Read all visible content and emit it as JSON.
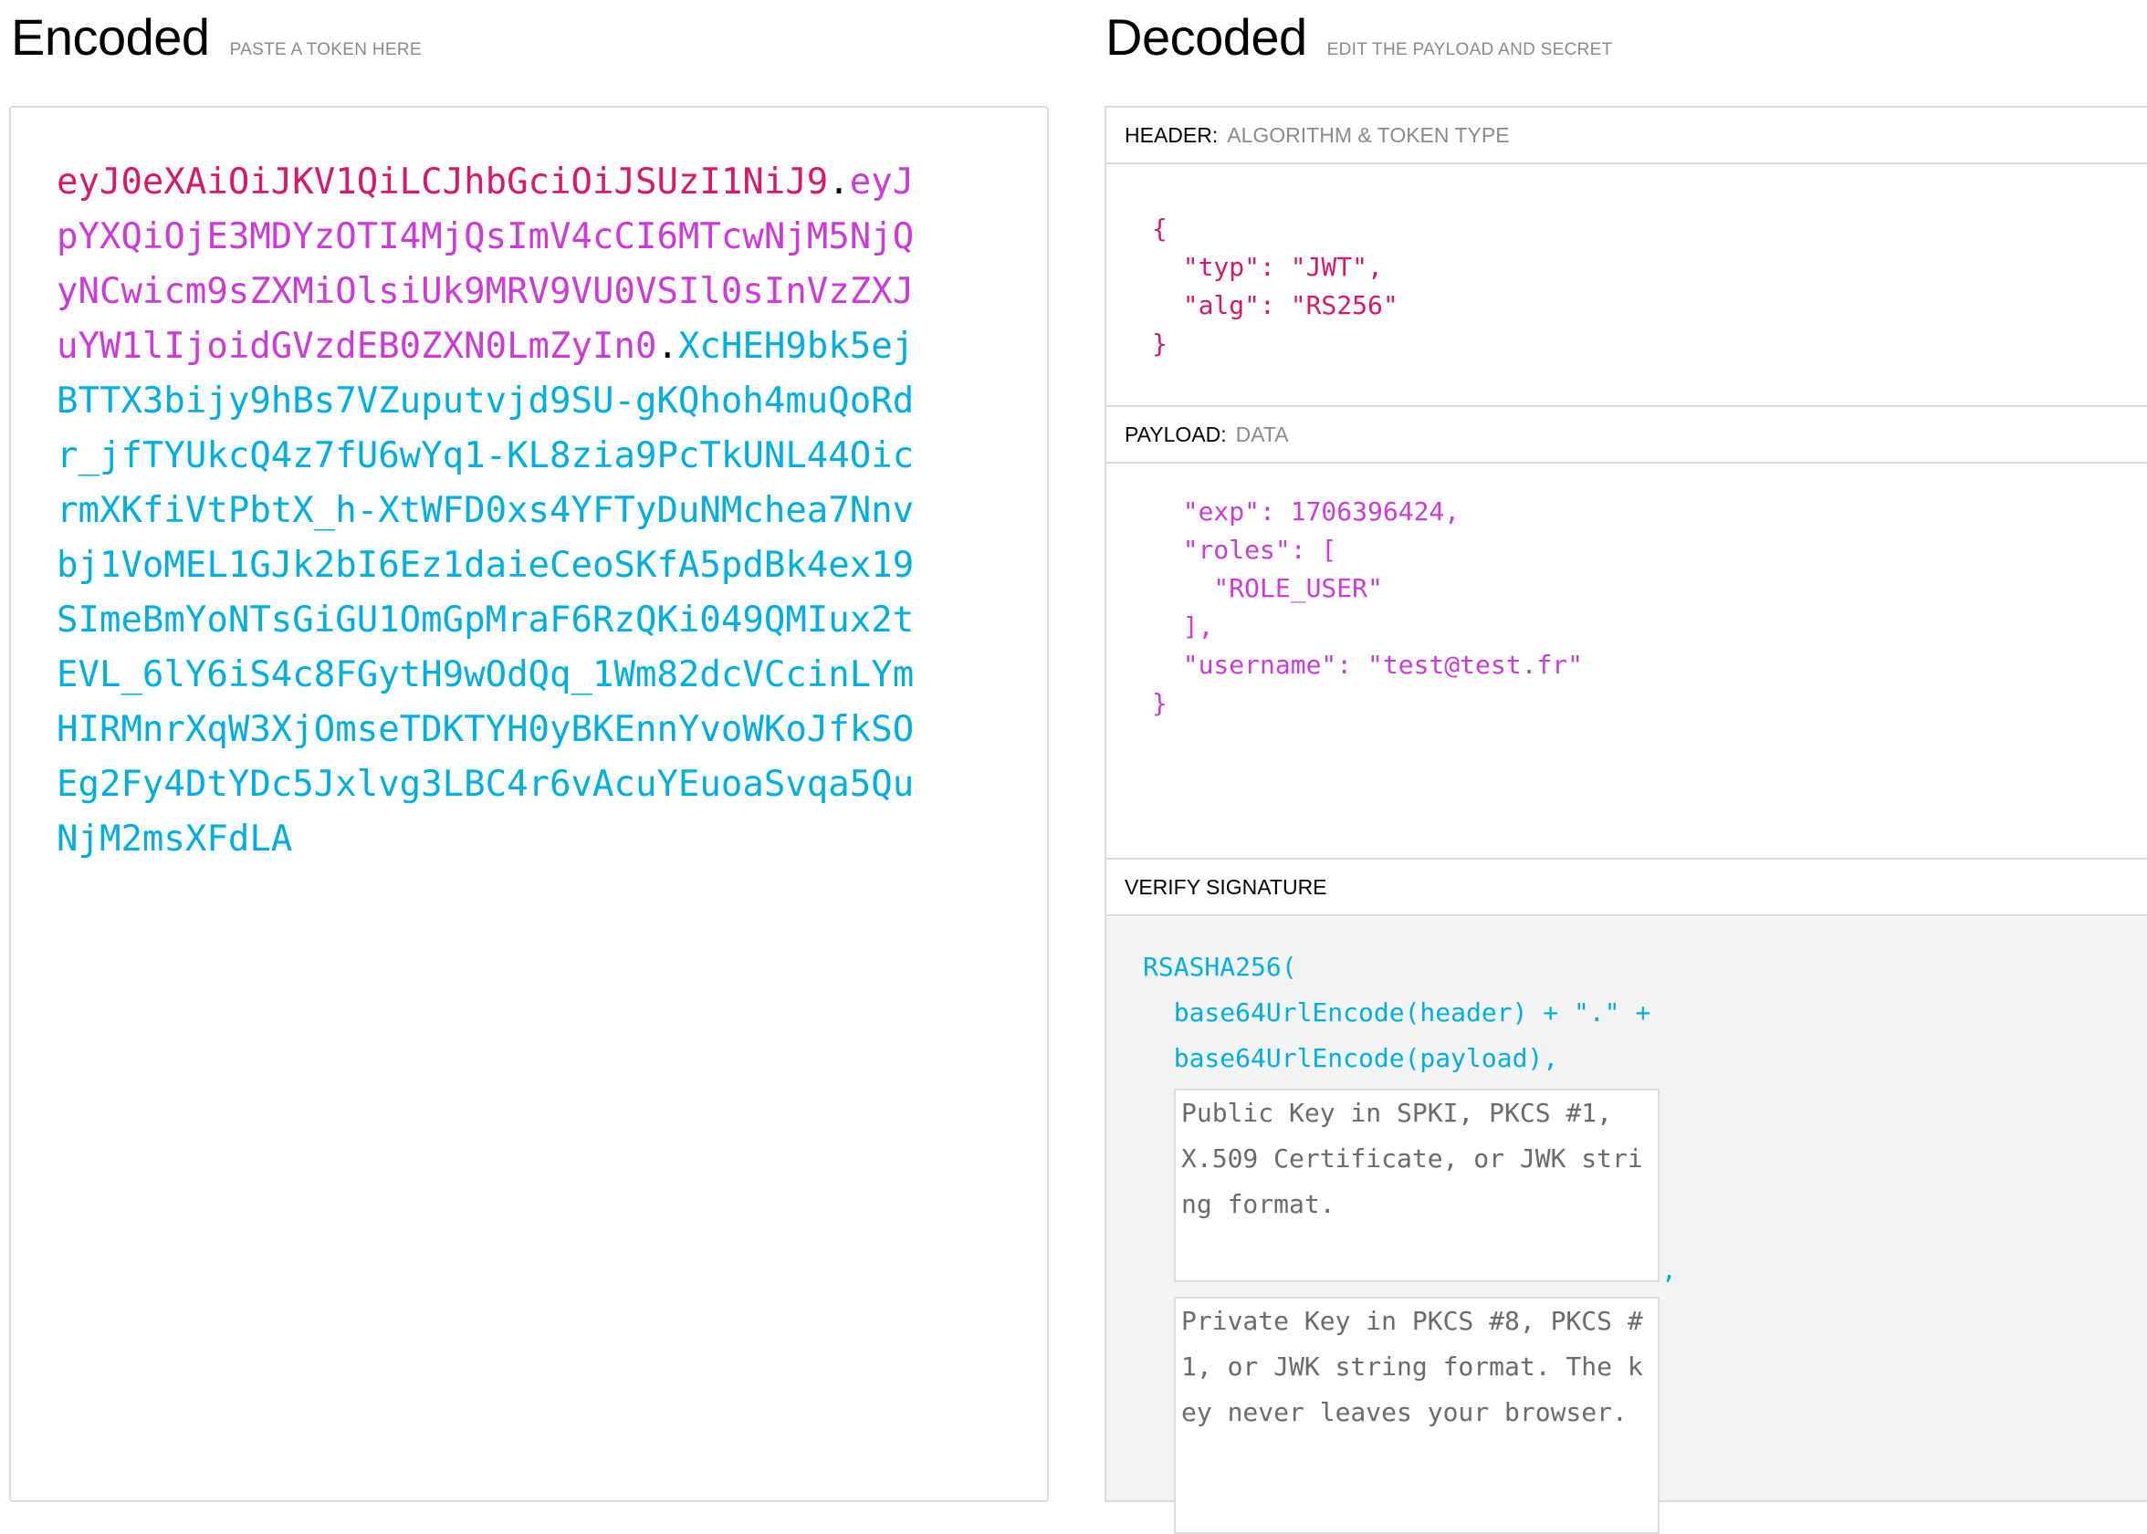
{
  "encoded": {
    "title": "Encoded",
    "subtitle": "PASTE A TOKEN HERE",
    "token": {
      "header": "eyJ0eXAiOiJKV1QiLCJhbGciOiJSUzI1NiJ9",
      "payload": "eyJpYXQiOjE3MDYzOTI4MjQsImV4cCI6MTcwNjM5NjQyNCwicm9sZXMiOlsiUk9MRV9VU0VSIl0sInVzZXJuYW1lIjoidGVzdEB0ZXN0LmZyIn0",
      "signature": "XcHEH9bk5ejBTTX3bijy9hBs7VZuputvjd9SU-gKQhoh4muQoRdr_jfTYUkcQ4z7fU6wYq1-KL8zia9PcTkUNL44OicrmXKfiVtPbtX_h-XtWFD0xs4YFTyDuNMchea7Nnvbj1VoMEL1GJk2bI6Ez1daieCeoSKfA5pdBk4ex19SImeBmYoNTsGiGU1OmGpMraF6RzQKi049QMIux2tEVL_6lY6iS4c8FGytH9wOdQq_1Wm82dcVCcinLYmHIRMnrXqW3XjOmseTDKTYH0yBKEnnYvoWKoJfkSOEg2Fy4DtYDc5Jxlvg3LBC4r6vAcuYEuoaSvqa5QuNjM2msXFdLA",
      "dot": "."
    }
  },
  "decoded": {
    "title": "Decoded",
    "subtitle": "EDIT THE PAYLOAD AND SECRET",
    "header_section": {
      "label": "HEADER:",
      "desc": "ALGORITHM & TOKEN TYPE",
      "json": "{\n  \"typ\": \"JWT\",\n  \"alg\": \"RS256\"\n}"
    },
    "payload_section": {
      "label": "PAYLOAD:",
      "desc": "DATA",
      "json": "  \"exp\": 1706396424,\n  \"roles\": [\n    \"ROLE_USER\"\n  ],\n  \"username\": \"test@test.fr\"\n}"
    },
    "verify_section": {
      "label": "VERIFY SIGNATURE",
      "line1": "RSASHA256(",
      "line2": "  base64UrlEncode(header) + \".\" +",
      "line3": "  base64UrlEncode(payload),",
      "public_key_placeholder": "Public Key in SPKI, PKCS #1, X.509 Certificate, or JWK string format.",
      "private_key_placeholder": "Private Key in PKCS #8, PKCS #1, or JWK string format. The key never leaves your browser.",
      "comma": ","
    }
  },
  "colors": {
    "header": "#d6196a",
    "payload": "#cc3bd8",
    "signature": "#00aee0",
    "border": "#dcdcdc"
  }
}
